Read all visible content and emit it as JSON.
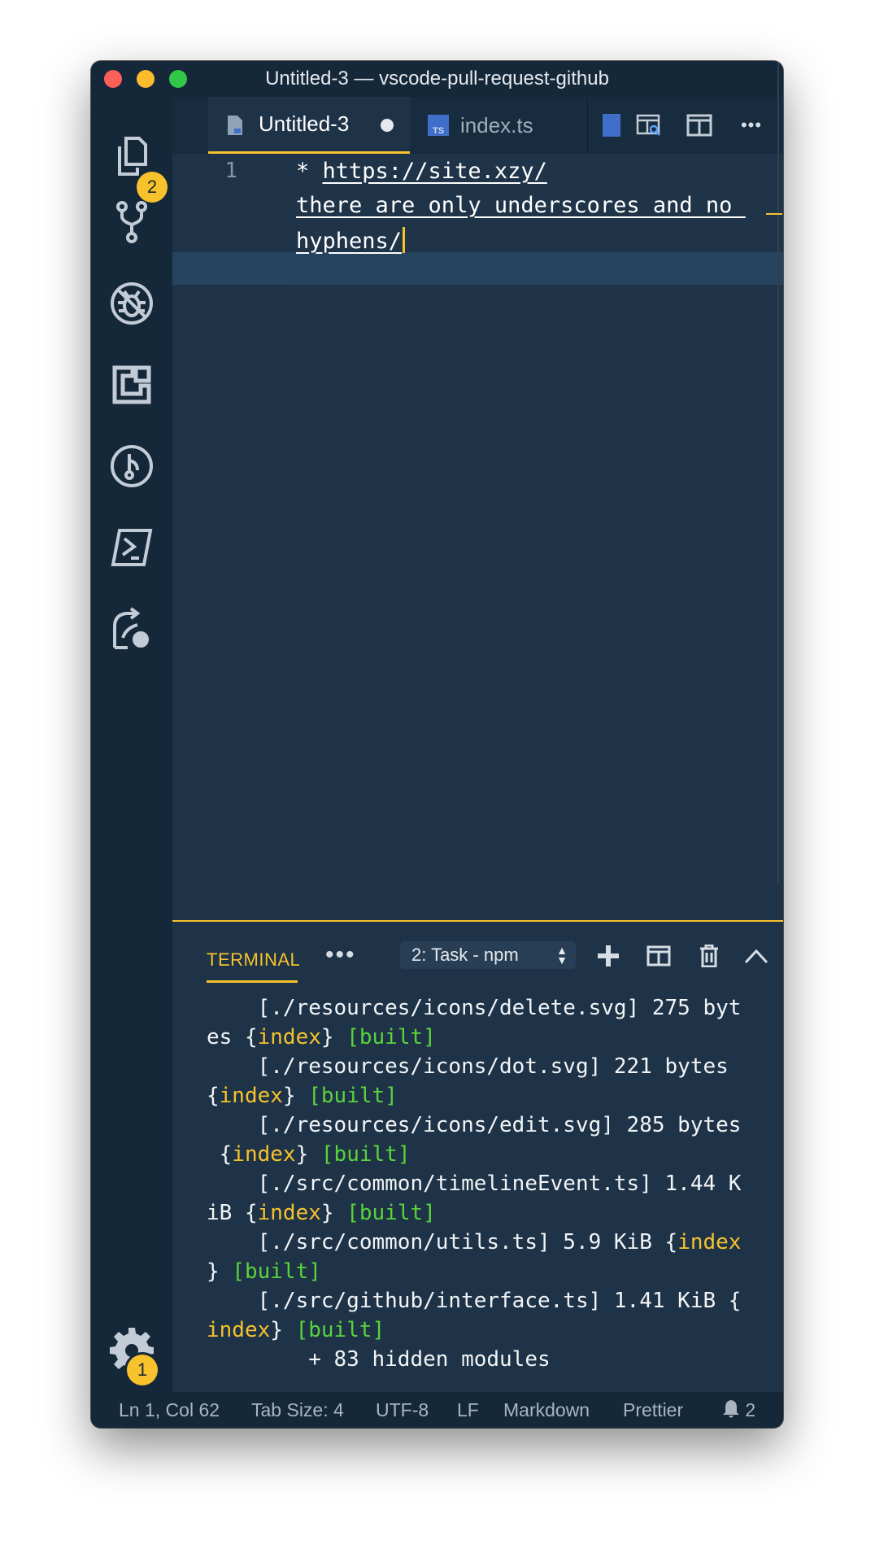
{
  "window": {
    "title": "Untitled-3 — vscode-pull-request-github"
  },
  "activity_bar": {
    "explorer_badge": "2",
    "settings_badge": "1"
  },
  "tabs": [
    {
      "label": "Untitled-3",
      "active": true,
      "dirty": true
    },
    {
      "label": "index.ts",
      "active": false,
      "icon": "TS"
    }
  ],
  "editor": {
    "line_number": "1",
    "lines": [
      {
        "prefix": "* ",
        "text": "https://site.xzy/"
      },
      {
        "prefix": "",
        "text": "there_are_only_underscores_and_no_"
      },
      {
        "prefix": "",
        "text": "hyphens/"
      }
    ]
  },
  "panel": {
    "tab_label": "TERMINAL",
    "more": "•••",
    "task_select": "2: Task - npm",
    "terminal_lines": [
      {
        "segments": [
          {
            "t": "    [./resources/icons/delete.svg] 275 byt",
            "c": "w"
          }
        ]
      },
      {
        "segments": [
          {
            "t": "es {",
            "c": "w"
          },
          {
            "t": "index",
            "c": "y"
          },
          {
            "t": "} ",
            "c": "w"
          },
          {
            "t": "[built]",
            "c": "g"
          }
        ]
      },
      {
        "segments": [
          {
            "t": "    [./resources/icons/dot.svg] 221 bytes",
            "c": "w"
          }
        ]
      },
      {
        "segments": [
          {
            "t": "{",
            "c": "w"
          },
          {
            "t": "index",
            "c": "y"
          },
          {
            "t": "} ",
            "c": "w"
          },
          {
            "t": "[built]",
            "c": "g"
          }
        ]
      },
      {
        "segments": [
          {
            "t": "    [./resources/icons/edit.svg] 285 bytes",
            "c": "w"
          }
        ]
      },
      {
        "segments": [
          {
            "t": " {",
            "c": "w"
          },
          {
            "t": "index",
            "c": "y"
          },
          {
            "t": "} ",
            "c": "w"
          },
          {
            "t": "[built]",
            "c": "g"
          }
        ]
      },
      {
        "segments": [
          {
            "t": "    [./src/common/timelineEvent.ts] 1.44 K",
            "c": "w"
          }
        ]
      },
      {
        "segments": [
          {
            "t": "iB {",
            "c": "w"
          },
          {
            "t": "index",
            "c": "y"
          },
          {
            "t": "} ",
            "c": "w"
          },
          {
            "t": "[built]",
            "c": "g"
          }
        ]
      },
      {
        "segments": [
          {
            "t": "    [./src/common/utils.ts] 5.9 KiB {",
            "c": "w"
          },
          {
            "t": "index",
            "c": "y"
          }
        ]
      },
      {
        "segments": [
          {
            "t": "} ",
            "c": "w"
          },
          {
            "t": "[built]",
            "c": "g"
          }
        ]
      },
      {
        "segments": [
          {
            "t": "    [./src/github/interface.ts] 1.41 KiB {",
            "c": "w"
          }
        ]
      },
      {
        "segments": [
          {
            "t": "index",
            "c": "y"
          },
          {
            "t": "} ",
            "c": "w"
          },
          {
            "t": "[built]",
            "c": "g"
          }
        ]
      },
      {
        "segments": [
          {
            "t": "        + 83 hidden modules",
            "c": "w"
          }
        ]
      }
    ]
  },
  "status_bar": {
    "position": "Ln 1, Col 62",
    "tab_size": "Tab Size: 4",
    "encoding": "UTF-8",
    "eol": "LF",
    "language": "Markdown",
    "formatter": "Prettier",
    "notifications": "2"
  },
  "colors": {
    "accent": "#f7c22c",
    "built": "#5ad33b",
    "background": "#1e3348",
    "ts_icon": "#3f6fc8"
  }
}
